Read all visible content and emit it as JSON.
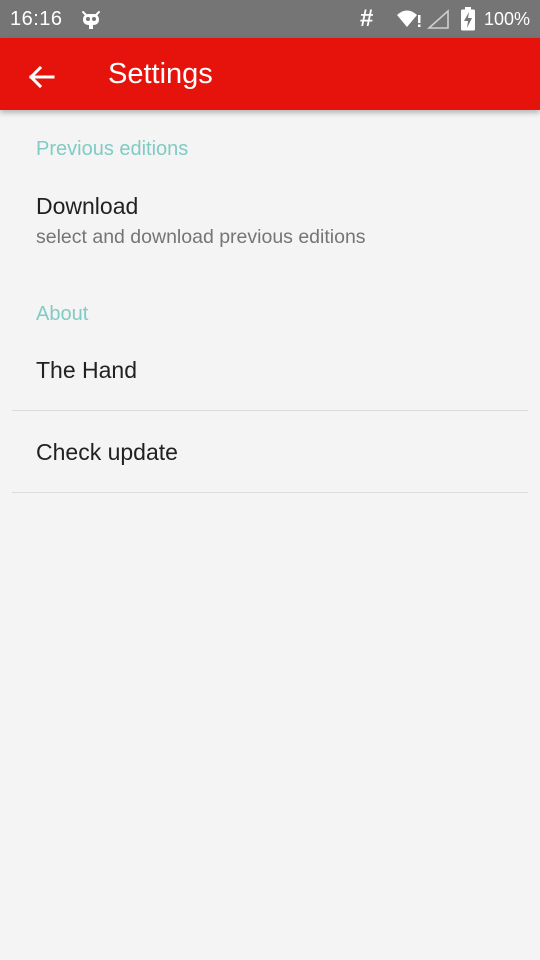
{
  "status_bar": {
    "time": "16:16",
    "battery_text": "100%",
    "hash_symbol": "#",
    "icons": [
      "cyanogenmod-icon",
      "hash-icon",
      "wifi-icon",
      "signal-icon",
      "battery-charging-icon"
    ]
  },
  "app_bar": {
    "title": "Settings",
    "back_icon": "arrow-back-icon",
    "color": "#e5130b"
  },
  "sections": [
    {
      "header": "Previous editions",
      "items": [
        {
          "title": "Download",
          "summary": "select and download previous editions"
        }
      ]
    },
    {
      "header": "About",
      "items": [
        {
          "title": "The Hand"
        },
        {
          "title": "Check update"
        }
      ]
    }
  ],
  "colors": {
    "accent": "#80cbc4",
    "background": "#f4f4f4",
    "status_bar": "#757575"
  }
}
